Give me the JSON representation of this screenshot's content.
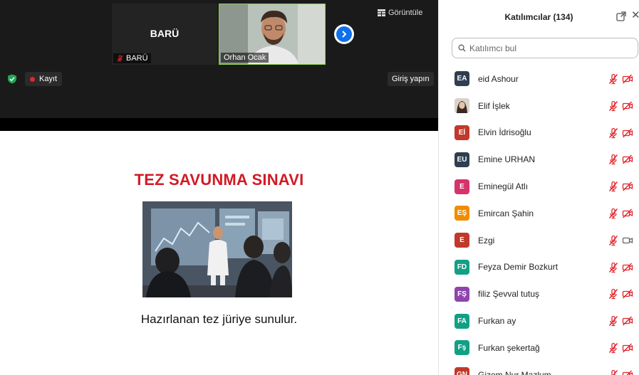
{
  "meeting": {
    "view_label": "Görüntüle",
    "record_label": "Kayıt",
    "signin_label": "Giriş yapın",
    "tiles": [
      {
        "center_name": "BARÜ",
        "label": "BARÜ"
      },
      {
        "label": "Orhan Ocak"
      }
    ],
    "slide": {
      "title": "TEZ SAVUNMA SINAVI",
      "caption": "Hazırlanan tez jüriye sunulur."
    }
  },
  "panel": {
    "title": "Katılımcılar (134)",
    "search_placeholder": "Katılımcı bul",
    "participants": [
      {
        "initials": "EA",
        "name": "eid Ashour",
        "color": "#2f3e50",
        "camera": "off"
      },
      {
        "initials": "",
        "name": "Elif İşlek",
        "color": "#c9c2bb",
        "photo": true,
        "camera": "off"
      },
      {
        "initials": "Eİ",
        "name": "Elvin İdrisoğlu",
        "color": "#c0392b",
        "camera": "off"
      },
      {
        "initials": "EU",
        "name": "Emine URHAN",
        "color": "#2f3e50",
        "camera": "off"
      },
      {
        "initials": "E",
        "name": "Eminegül Atlı",
        "color": "#d6336c",
        "camera": "off"
      },
      {
        "initials": "EŞ",
        "name": "Emircan Şahin",
        "color": "#f08c00",
        "camera": "off"
      },
      {
        "initials": "E",
        "name": "Ezgi",
        "color": "#c0392b",
        "camera": "on"
      },
      {
        "initials": "FD",
        "name": "Feyza Demir Bozkurt",
        "color": "#12a085",
        "camera": "off"
      },
      {
        "initials": "FŞ",
        "name": "filiz Şevval tutuş",
        "color": "#8e44ad",
        "camera": "off"
      },
      {
        "initials": "FA",
        "name": "Furkan ay",
        "color": "#12a085",
        "camera": "off"
      },
      {
        "initials": "Fş",
        "name": "Furkan şekertağ",
        "color": "#12a085",
        "camera": "off"
      },
      {
        "initials": "GN",
        "name": "Gizem Nur Mazlum",
        "color": "#c0392b",
        "camera": "off"
      }
    ]
  },
  "colors": {
    "accent": "#0e71eb",
    "muted_red": "#e0242c",
    "title_red": "#d21a26",
    "active_speaker": "#8ed34a"
  }
}
